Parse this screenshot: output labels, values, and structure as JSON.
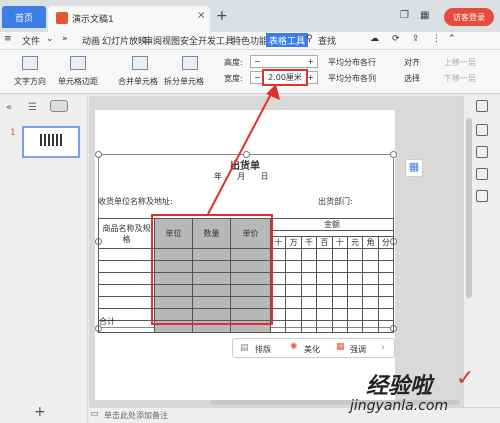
{
  "titlebar": {
    "home_tab": "首页",
    "doc_tab": "演示文稿1",
    "login_btn": "访客登录"
  },
  "menu": {
    "file": "文件",
    "items": [
      "动画",
      "幻灯片放映",
      "审阅",
      "视图",
      "安全",
      "开发工具",
      "特色功能"
    ],
    "active": "表格工具",
    "search": "查找"
  },
  "ribbon": {
    "text_direction": "文字方向",
    "cell_margin": "单元格边距",
    "merge": "合并单元格",
    "split": "拆分单元格",
    "height_label": "高度:",
    "width_label": "宽度:",
    "width_value": "2.00厘米",
    "dist_rows": "平均分布各行",
    "dist_cols": "平均分布各列",
    "align": "对齐",
    "select": "选择",
    "up_layer": "上移一层",
    "down_layer": "下移一层"
  },
  "slide": {
    "number": "1",
    "title": "出货单",
    "date_line": "年      月      日",
    "receiver": "收货单位名称及地址:",
    "dept": "出货部门:",
    "col_product": "商品名称及规格",
    "col_unit": "单位",
    "col_qty": "数量",
    "col_price": "单价",
    "col_amount": "金额",
    "amount_units": [
      "十",
      "万",
      "千",
      "百",
      "十",
      "元",
      "角",
      "分"
    ],
    "total": "合计"
  },
  "quickbar": {
    "layout": "排版",
    "beautify": "美化",
    "emphasize": "强调"
  },
  "statusbar": {
    "notes": "单击此处添加备注"
  },
  "watermark": {
    "line1": "经验啦",
    "line2": "jingyanla.com"
  },
  "colors": {
    "accent": "#3c7de6",
    "annotation": "#e03030"
  }
}
